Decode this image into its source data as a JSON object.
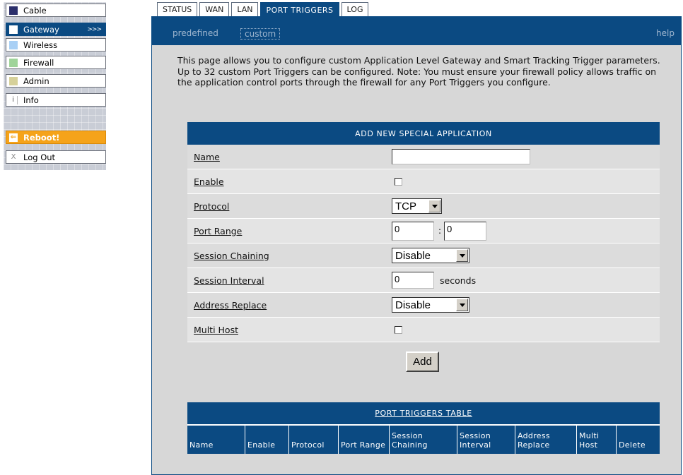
{
  "sidebar": {
    "items": [
      {
        "label": "Cable",
        "icon": "dark-square-icon",
        "color": "#2b2f6b"
      },
      {
        "label": "Gateway",
        "icon": "white-square-icon",
        "arrow": ">>>",
        "color": "#ffffff"
      },
      {
        "label": "Wireless",
        "icon": "light-blue-square-icon",
        "color": "#a9d0f5"
      },
      {
        "label": "Firewall",
        "icon": "green-square-icon",
        "color": "#9fd49a"
      },
      {
        "label": "Admin",
        "icon": "khaki-square-icon",
        "color": "#d6d19a"
      },
      {
        "label": "Info",
        "icon": "info-icon",
        "glyph": "i"
      },
      {
        "label": "Reboot!",
        "icon": "reboot-arrow-icon",
        "glyph": "⇐"
      },
      {
        "label": "Log Out",
        "icon": "close-x-icon",
        "glyph": "X"
      }
    ]
  },
  "tabs": [
    {
      "label": "STATUS"
    },
    {
      "label": "WAN"
    },
    {
      "label": "LAN"
    },
    {
      "label": "PORT TRIGGERS",
      "active": true
    },
    {
      "label": "LOG"
    }
  ],
  "subnav": {
    "predefined": "predefined",
    "custom": "custom",
    "help": "help"
  },
  "intro": "This page allows you to configure custom Application Level Gateway and Smart Tracking Trigger parameters. Up to 32 custom Port Triggers can be configured. Note: You must ensure your firewall policy allows traffic on the application control ports through the firewall for any Port Triggers you configure.",
  "form": {
    "title": "ADD NEW SPECIAL APPLICATION",
    "name_label": "Name",
    "name_value": "",
    "enable_label": "Enable",
    "protocol_label": "Protocol",
    "protocol_value": "TCP",
    "port_range_label": "Port Range",
    "port_start": "0",
    "port_sep": ":",
    "port_end": "0",
    "session_chaining_label": "Session Chaining",
    "session_chaining_value": "Disable",
    "session_interval_label": "Session Interval",
    "session_interval_value": "0",
    "session_interval_unit": "seconds",
    "address_replace_label": "Address Replace",
    "address_replace_value": "Disable",
    "multi_host_label": "Multi Host",
    "add_button": "Add"
  },
  "triggers_table": {
    "title": "PORT TRIGGERS TABLE",
    "columns": [
      "Name",
      "Enable",
      "Protocol",
      "Port Range",
      "Session Chaining",
      "Session Interval",
      "Address Replace",
      "Multi Host",
      "Delete"
    ]
  },
  "colors": {
    "accent": "#0b4a82",
    "panel": "#d7d7d7",
    "reboot": "#f5a31a"
  }
}
